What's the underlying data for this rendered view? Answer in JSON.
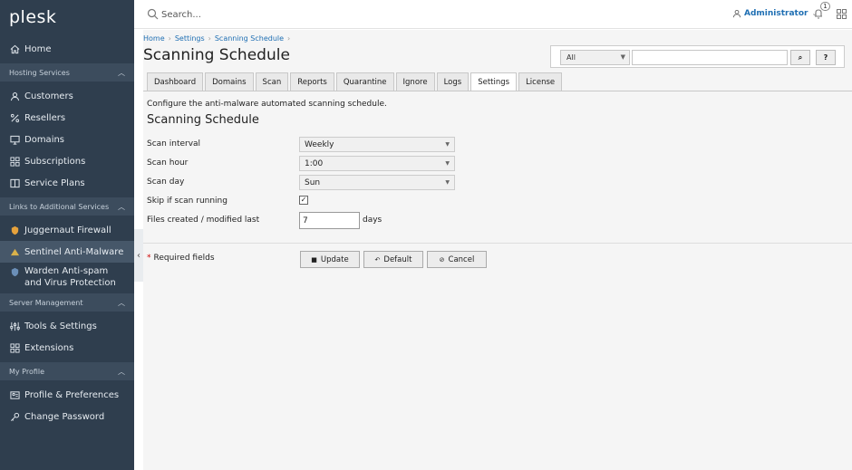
{
  "sidebar": {
    "logo": "plesk",
    "home": "Home",
    "sections": [
      {
        "title": "Hosting Services",
        "items": [
          "Customers",
          "Resellers",
          "Domains",
          "Subscriptions",
          "Service Plans"
        ]
      },
      {
        "title": "Links to Additional Services",
        "items": [
          "Juggernaut Firewall",
          "Sentinel Anti-Malware",
          "Warden Anti-spam and Virus Protection"
        ]
      },
      {
        "title": "Server Management",
        "items": [
          "Tools & Settings",
          "Extensions"
        ]
      },
      {
        "title": "My Profile",
        "items": [
          "Profile & Preferences",
          "Change Password"
        ]
      }
    ],
    "active_item": "Sentinel Anti-Malware"
  },
  "topbar": {
    "search_placeholder": "Search...",
    "user": "Administrator",
    "notification_count": "1"
  },
  "breadcrumb": [
    "Home",
    "Settings",
    "Scanning Schedule"
  ],
  "page_title": "Scanning Schedule",
  "filter": {
    "select_value": "All",
    "search_button": "⌕",
    "help_button": "?"
  },
  "tabs": [
    "Dashboard",
    "Domains",
    "Scan",
    "Reports",
    "Quarantine",
    "Ignore",
    "Logs",
    "Settings",
    "License"
  ],
  "active_tab": "Settings",
  "description": "Configure the anti-malware automated scanning schedule.",
  "section_title": "Scanning Schedule",
  "form": {
    "scan_interval_label": "Scan interval",
    "scan_interval_value": "Weekly",
    "scan_hour_label": "Scan hour",
    "scan_hour_value": "1:00",
    "scan_day_label": "Scan day",
    "scan_day_value": "Sun",
    "skip_label": "Skip if scan running",
    "skip_checked": true,
    "files_label": "Files created / modified last",
    "files_value": "7",
    "files_unit": "days"
  },
  "required_fields": "Required fields",
  "buttons": {
    "update": "Update",
    "default": "Default",
    "cancel": "Cancel"
  }
}
